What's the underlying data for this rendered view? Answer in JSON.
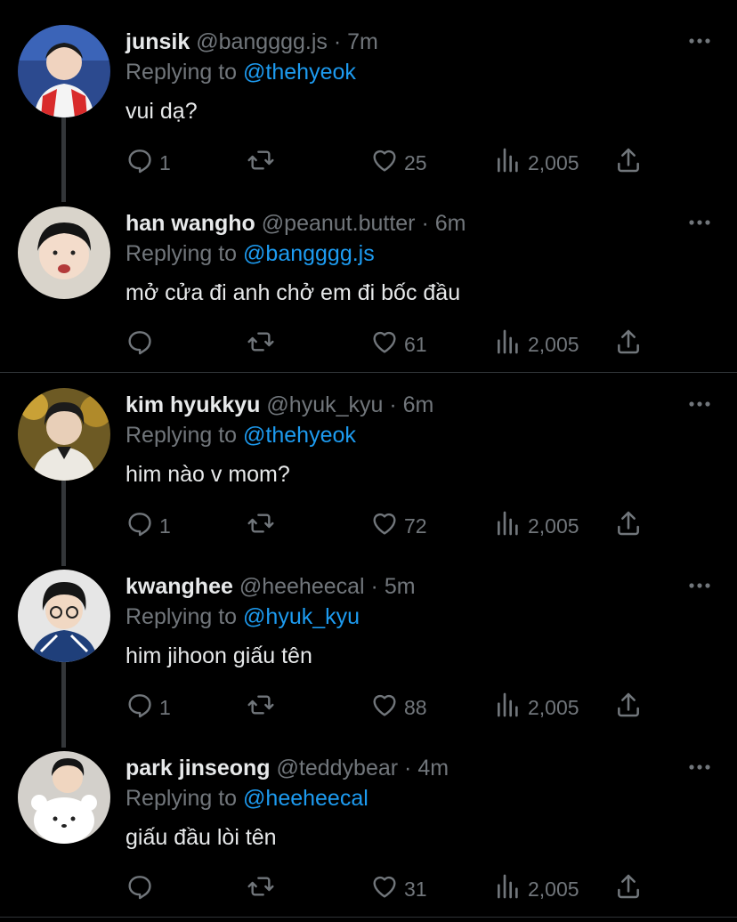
{
  "tweets": [
    {
      "name": "junsik",
      "handle": "@bangggg.js",
      "dot": "·",
      "time": "7m",
      "replying_label": "Replying to",
      "mention": "@thehyeok",
      "text": "vui dạ?",
      "reply_count": "1",
      "like_count": "25",
      "view_count": "2,005"
    },
    {
      "name": "han wangho",
      "handle": "@peanut.butter",
      "dot": "·",
      "time": "6m",
      "replying_label": "Replying to",
      "mention": "@bangggg.js",
      "text": "mở cửa đi anh chở em đi bốc đầu",
      "reply_count": "",
      "like_count": "61",
      "view_count": "2,005"
    },
    {
      "name": "kim hyukkyu",
      "handle": "@hyuk_kyu",
      "dot": "·",
      "time": "6m",
      "replying_label": "Replying to",
      "mention": "@thehyeok",
      "text": "him nào v mom?",
      "reply_count": "1",
      "like_count": "72",
      "view_count": "2,005"
    },
    {
      "name": "kwanghee",
      "handle": "@heeheecal",
      "dot": "·",
      "time": "5m",
      "replying_label": "Replying to",
      "mention": "@hyuk_kyu",
      "text": "him jihoon giấu tên",
      "reply_count": "1",
      "like_count": "88",
      "view_count": "2,005"
    },
    {
      "name": "park jinseong",
      "handle": "@teddybear",
      "dot": "·",
      "time": "4m",
      "replying_label": "Replying to",
      "mention": "@heeheecal",
      "text": "giấu đầu lòi tên",
      "reply_count": "",
      "like_count": "31",
      "view_count": "2,005"
    }
  ],
  "icons": {
    "more": "more-horizontal-icon",
    "reply": "reply-icon",
    "retweet": "retweet-icon",
    "like": "heart-icon",
    "views": "views-icon",
    "share": "share-icon"
  },
  "colors": {
    "background": "#000000",
    "name": "#e7e9ea",
    "muted": "#71767b",
    "mention": "#1d9bf0",
    "divider": "#2f3336"
  }
}
